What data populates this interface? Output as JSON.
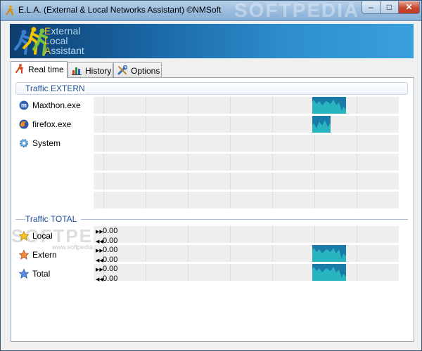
{
  "window": {
    "title": "E.L.A. (External & Local Networks Assistant) ©NMSoft",
    "watermark": "SOFTPEDIA",
    "controls": {
      "minimize": "–",
      "maximize": "□",
      "close": "✕"
    }
  },
  "banner": {
    "line1": "External",
    "line2": "Local",
    "line3": "Assistant",
    "cap1": "E",
    "rest1": "xternal",
    "cap2": "L",
    "rest2": "ocal",
    "cap3": "A",
    "rest3": "ssistant"
  },
  "tabs": [
    {
      "label": "Real time",
      "icon": "runner-icon",
      "active": true
    },
    {
      "label": "History",
      "icon": "bar-chart-icon",
      "active": false
    },
    {
      "label": "Options",
      "icon": "tools-icon",
      "active": false
    }
  ],
  "extern": {
    "title": "Traffic EXTERN",
    "rows": [
      {
        "name": "Maxthon.exe",
        "icon": "maxthon-icon"
      },
      {
        "name": "firefox.exe",
        "icon": "firefox-icon"
      },
      {
        "name": "System",
        "icon": "gear-icon"
      },
      {
        "name": ""
      },
      {
        "name": ""
      },
      {
        "name": ""
      }
    ]
  },
  "total": {
    "title": "Traffic TOTAL",
    "watermark": "SOFTPEDIA",
    "watermark_url": "www.softpedia.com",
    "rows": [
      {
        "name": "Local",
        "icon": "star-yellow-icon",
        "up": "0.00",
        "down": "0.00"
      },
      {
        "name": "Extern",
        "icon": "star-orange-icon",
        "up": "0.00",
        "down": "0.00"
      },
      {
        "name": "Total",
        "icon": "star-blue-icon",
        "up": "0.00",
        "down": "0.00"
      }
    ]
  },
  "colors": {
    "accent": "#1e4e98",
    "graph_fill": "#29b5bf",
    "graph_bg": "#efefef"
  }
}
